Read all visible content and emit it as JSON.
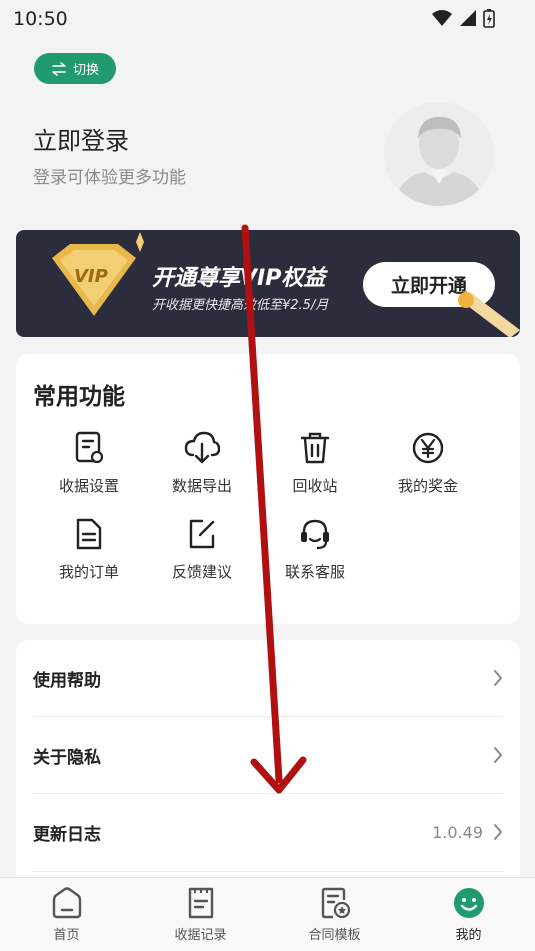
{
  "status": {
    "time": "10:50"
  },
  "switch": {
    "label": "切换"
  },
  "profile": {
    "title": "立即登录",
    "subtitle": "登录可体验更多功能"
  },
  "vip": {
    "badge": "VIP",
    "title": "开通尊享VIP权益",
    "subtitle": "开收据更快捷高效低至¥2.5/月",
    "button": "立即开通"
  },
  "functions": {
    "title": "常用功能",
    "items": [
      {
        "label": "收据设置",
        "icon": "receipt-settings-icon"
      },
      {
        "label": "数据导出",
        "icon": "cloud-download-icon"
      },
      {
        "label": "回收站",
        "icon": "trash-icon"
      },
      {
        "label": "我的奖金",
        "icon": "yen-circle-icon"
      },
      {
        "label": "我的订单",
        "icon": "document-icon"
      },
      {
        "label": "反馈建议",
        "icon": "edit-icon"
      },
      {
        "label": "联系客服",
        "icon": "headset-icon"
      }
    ]
  },
  "menu": {
    "items": [
      {
        "label": "使用帮助",
        "value": ""
      },
      {
        "label": "关于隐私",
        "value": ""
      },
      {
        "label": "更新日志",
        "value": "1.0.49"
      }
    ]
  },
  "tabs": [
    {
      "label": "首页",
      "icon": "home-icon",
      "active": false
    },
    {
      "label": "收据记录",
      "icon": "receipt-list-icon",
      "active": false
    },
    {
      "label": "合同模板",
      "icon": "contract-template-icon",
      "active": false
    },
    {
      "label": "我的",
      "icon": "smile-face-icon",
      "active": true
    }
  ],
  "colors": {
    "brand": "#1f9b6d",
    "vip_bg": "#2b2d3d",
    "vip_gold": "#e8b84a",
    "arrow": "#b01010"
  }
}
